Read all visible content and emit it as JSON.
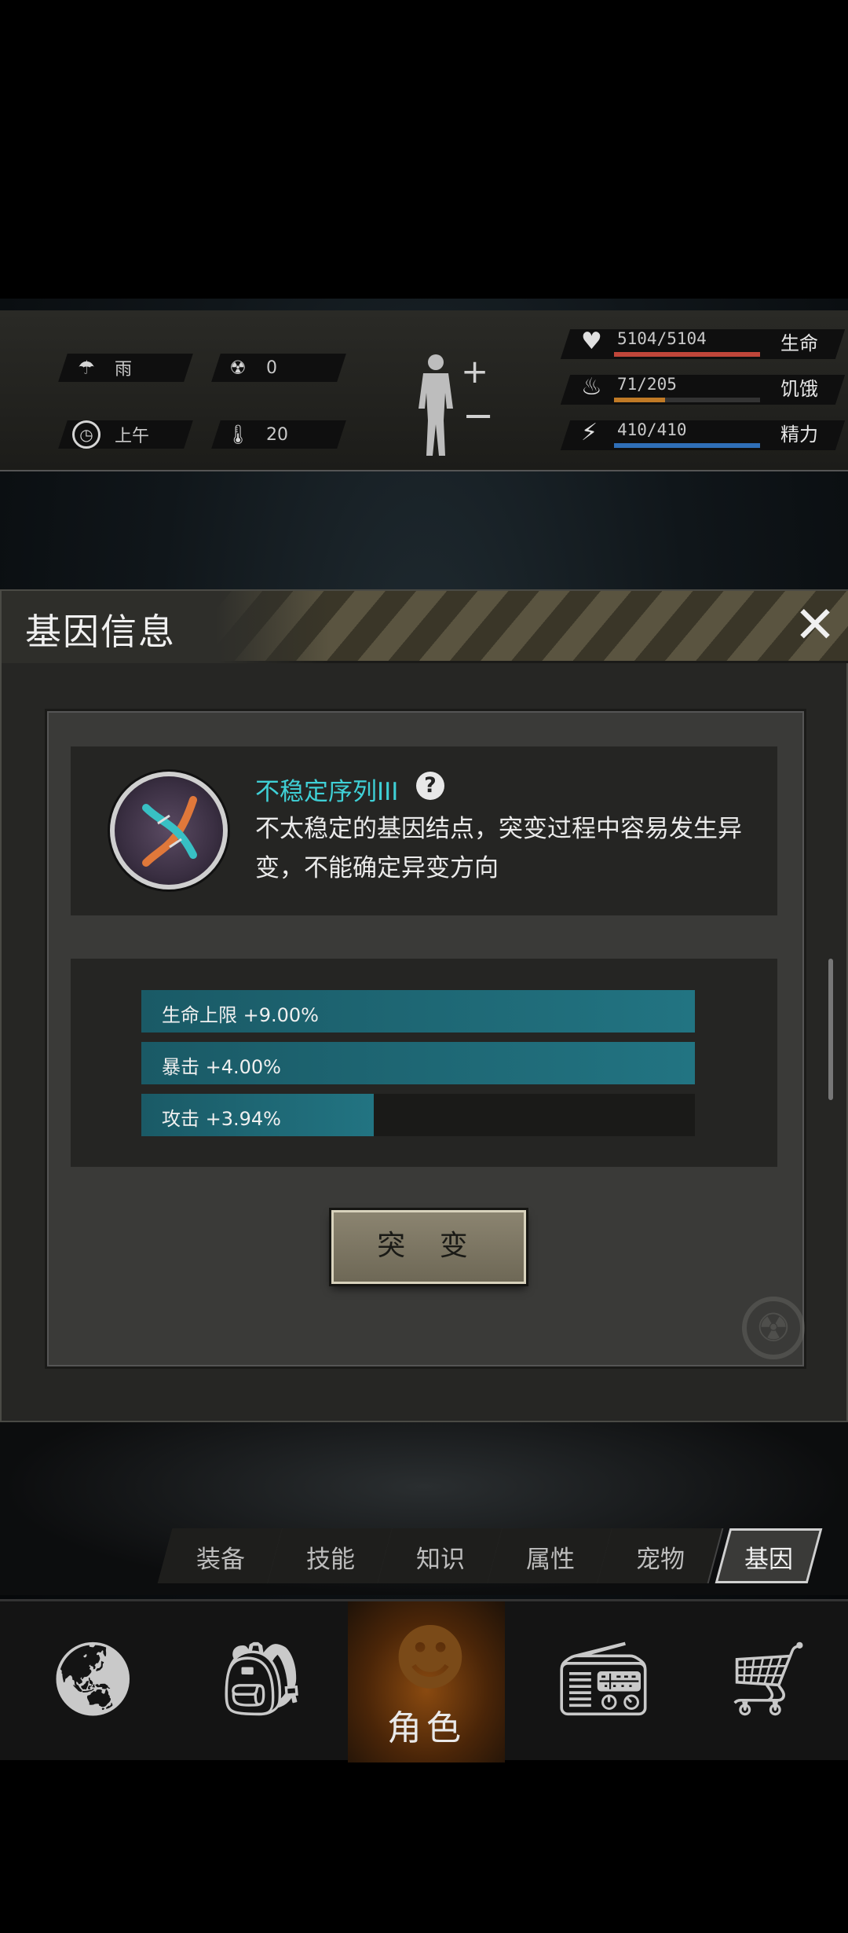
{
  "status": {
    "weather": {
      "icon": "rain-cloud-icon",
      "label": "雨"
    },
    "radiation": {
      "icon": "radiation-icon",
      "value": "0"
    },
    "time": {
      "icon": "clock-icon",
      "label": "上午"
    },
    "temperature": {
      "icon": "thermometer-icon",
      "value": "20"
    },
    "stats": [
      {
        "icon": "heart-icon",
        "value": "5104/5104",
        "label": "生命",
        "fill": 1.0,
        "color": "#c0463a"
      },
      {
        "icon": "stomach-icon",
        "value": "71/205",
        "label": "饥饿",
        "fill": 0.35,
        "color": "#c07a26"
      },
      {
        "icon": "brain-energy-icon",
        "value": "410/410",
        "label": "精力",
        "fill": 1.0,
        "color": "#2f6fb8"
      }
    ]
  },
  "dialog": {
    "title": "基因信息",
    "gene": {
      "name": "不稳定序列III",
      "description": "不太稳定的基因结点，突变过程中容易发生异变，不能确定异变方向"
    },
    "attributes": [
      {
        "label": "生命上限 +9.00%",
        "fill": 1.0
      },
      {
        "label": "暴击 +4.00%",
        "fill": 1.0
      },
      {
        "label": "攻击 +3.94%",
        "fill": 0.42
      }
    ],
    "mutate_label": "突 变"
  },
  "tabs": [
    {
      "label": "装备",
      "active": false
    },
    {
      "label": "技能",
      "active": false
    },
    {
      "label": "知识",
      "active": false
    },
    {
      "label": "属性",
      "active": false
    },
    {
      "label": "宠物",
      "active": false
    },
    {
      "label": "基因",
      "active": true
    }
  ],
  "nav": [
    {
      "icon": "globe-icon",
      "label": ""
    },
    {
      "icon": "backpack-icon",
      "label": ""
    },
    {
      "icon": "character-head-icon",
      "label": "角色",
      "active": true
    },
    {
      "icon": "radio-icon",
      "label": ""
    },
    {
      "icon": "shopping-cart-icon",
      "label": ""
    }
  ]
}
